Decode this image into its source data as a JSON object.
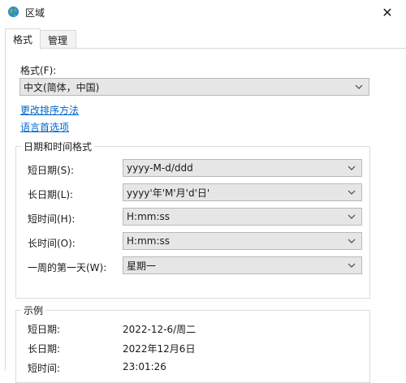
{
  "window": {
    "title": "区域",
    "close_glyph": "✕",
    "icon": "globe-icon"
  },
  "tabs": [
    {
      "label": "格式",
      "active": true
    },
    {
      "label": "管理",
      "active": false
    }
  ],
  "format": {
    "label": "格式(F):",
    "value": "中文(简体，中国)"
  },
  "links": {
    "sort": "更改排序方法",
    "language": "语言首选项"
  },
  "datetime": {
    "group_title": "日期和时间格式",
    "rows": [
      {
        "label": "短日期(S):",
        "value": "yyyy-M-d/ddd"
      },
      {
        "label": "长日期(L):",
        "value": "yyyy'年'M'月'd'日'"
      },
      {
        "label": "短时间(H):",
        "value": "H:mm:ss"
      },
      {
        "label": "长时间(O):",
        "value": "H:mm:ss"
      },
      {
        "label": "一周的第一天(W):",
        "value": "星期一"
      }
    ]
  },
  "examples": {
    "group_title": "示例",
    "rows": [
      {
        "label": "短日期:",
        "value": "2022-12-6/周二"
      },
      {
        "label": "长日期:",
        "value": "2022年12月6日"
      },
      {
        "label": "短时间:",
        "value": "23:01:26"
      }
    ]
  },
  "colors": {
    "link": "#0066cc",
    "combo_bg": "#e6e6e6"
  }
}
